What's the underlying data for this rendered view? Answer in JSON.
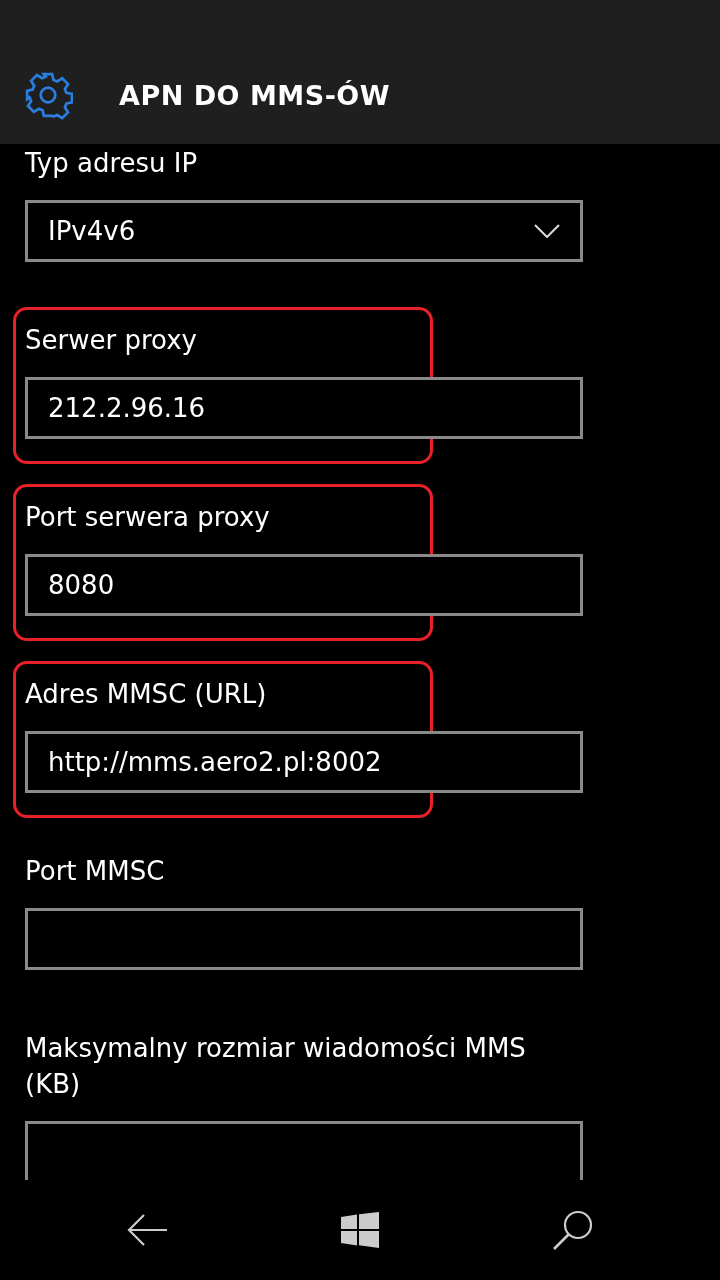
{
  "header": {
    "title": "APN DO MMS-ÓW"
  },
  "fields": [
    {
      "kind": "dropdown",
      "label": "Typ adresu IP",
      "value": "IPv4v6",
      "highlighted": false
    },
    {
      "kind": "text",
      "label": "Serwer proxy",
      "value": "212.2.96.16",
      "highlighted": true
    },
    {
      "kind": "text",
      "label": "Port serwera proxy",
      "value": "8080",
      "highlighted": true
    },
    {
      "kind": "text",
      "label": "Adres MMSC (URL)",
      "value": "http://mms.aero2.pl:8002",
      "highlighted": true
    },
    {
      "kind": "text",
      "label": "Port MMSC",
      "highlighted": false
    },
    {
      "kind": "text",
      "label": "Maksymalny rozmiar wiadomości MMS (KB)",
      "highlighted": false
    }
  ]
}
